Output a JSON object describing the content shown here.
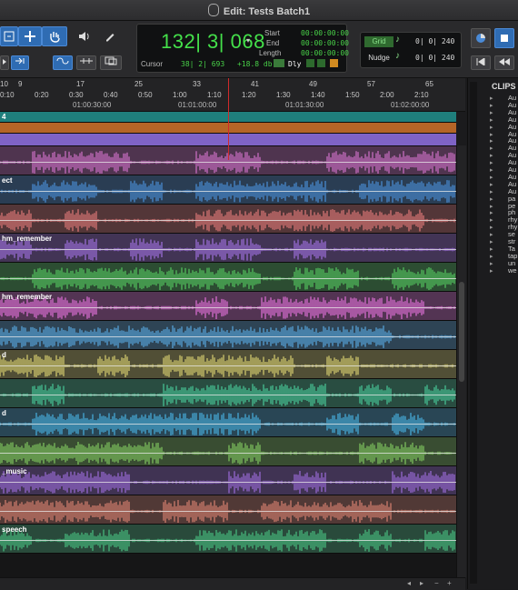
{
  "window": {
    "title": "Edit: Tests Batch1"
  },
  "counter": {
    "main": "132| 3| 068",
    "start_label": "Start",
    "end_label": "End",
    "length_label": "Length",
    "start": "00:00:00:00",
    "end": "00:00:00:00",
    "length": "00:00:00:00",
    "cursor_label": "Cursor",
    "cursor_value": "38| 2| 693",
    "db": "+18.8 db",
    "dly": "Dly"
  },
  "grid": {
    "grid_label": "Grid",
    "grid_value": "0| 0| 240",
    "nudge_label": "Nudge",
    "nudge_value": "0| 0| 240"
  },
  "ruler": {
    "bars": [
      "9",
      "17",
      "25",
      "33",
      "41",
      "49",
      "57",
      "65"
    ],
    "minsec": [
      "0:10",
      "0:20",
      "0:30",
      "0:40",
      "0:50",
      "1:00",
      "1:10",
      "1:20",
      "1:30",
      "1:40",
      "1:50",
      "2:00",
      "2:10"
    ],
    "timecode": [
      "01:00:30:00",
      "01:01:00:00",
      "01:01:30:00",
      "01:02:00:00"
    ],
    "left_labels": [
      "10",
      "0"
    ]
  },
  "tracks": [
    {
      "name": "4",
      "color": "#1f8a86"
    },
    {
      "name": "",
      "color": "#c46d28"
    },
    {
      "name": "",
      "color": "#8a6ad8"
    },
    {
      "name": "",
      "color": "#d070c8"
    },
    {
      "name": "ect",
      "color": "#4a8fd8"
    },
    {
      "name": "",
      "color": "#e07878"
    },
    {
      "name": "hm_remember",
      "color": "#a070e0"
    },
    {
      "name": "",
      "color": "#54c860"
    },
    {
      "name": "hm_remember",
      "color": "#e070d8"
    },
    {
      "name": "",
      "color": "#58a8e0"
    },
    {
      "name": "d",
      "color": "#d8d070"
    },
    {
      "name": "",
      "color": "#48c898"
    },
    {
      "name": "d",
      "color": "#48b0e0"
    },
    {
      "name": "",
      "color": "#80c860"
    },
    {
      "name": "_music",
      "color": "#9a6ad8"
    },
    {
      "name": "",
      "color": "#d88070"
    },
    {
      "name": "speech",
      "color": "#48c080"
    }
  ],
  "clips": {
    "title": "CLIPS",
    "items": [
      "Au",
      "Au",
      "Au",
      "Au",
      "Au",
      "Au",
      "Au",
      "Au",
      "Au",
      "Au",
      "Au",
      "Au",
      "Au",
      "Au",
      "pa",
      "pe",
      "ph",
      "rhy",
      "rhy",
      "se",
      "str",
      "Ta",
      "tap",
      "un",
      "we"
    ]
  }
}
